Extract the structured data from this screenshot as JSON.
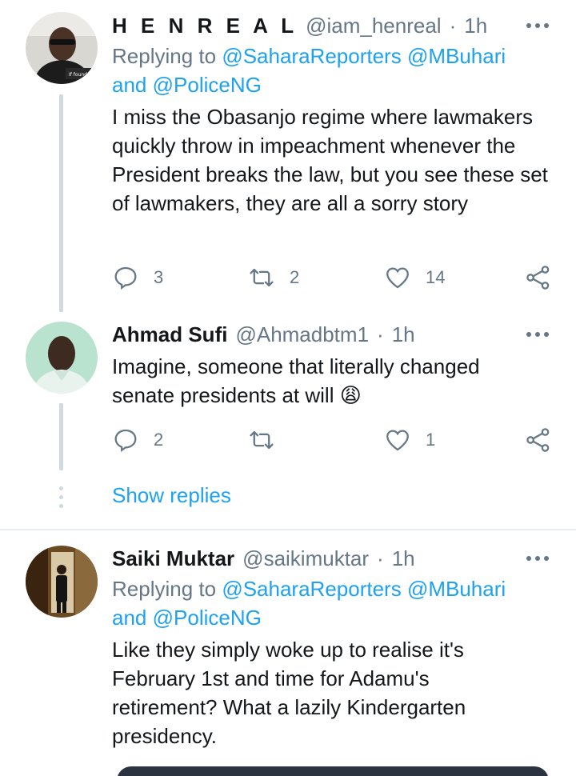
{
  "tweets": [
    {
      "name": "H E N R E A L",
      "handle": "@iam_henreal",
      "separator": "·",
      "time": "1h",
      "replying_prefix": "Replying to",
      "replying_to_1": "@SaharaReporters",
      "replying_to_2": "@MBuhari",
      "replying_and": "and",
      "replying_to_3": "@PoliceNG",
      "text": "I miss the Obasanjo regime where lawmakers quickly throw in impeachment whenever the President breaks the law, but you see these set of lawmakers, they are all a sorry story",
      "replies": "3",
      "retweets": "2",
      "likes": "14"
    },
    {
      "name": "Ahmad Sufi",
      "handle": "@Ahmadbtm1",
      "separator": "·",
      "time": "1h",
      "text": "Imagine, someone that literally changed senate presidents at will",
      "emoji": "😩",
      "replies": "2",
      "retweets": "",
      "likes": "1"
    },
    {
      "name": "Saiki Muktar",
      "handle": "@saikimuktar",
      "separator": "·",
      "time": "1h",
      "replying_prefix": "Replying to",
      "replying_to_1": "@SaharaReporters",
      "replying_to_2": "@MBuhari",
      "replying_and": "and",
      "replying_to_3": "@PoliceNG",
      "text": "Like they simply woke up to realise it's February 1st and time for Adamu's retirement? What a lazily Kindergarten presidency."
    }
  ],
  "show_replies": "Show replies",
  "colors": {
    "link": "#1da1f2",
    "muted": "#657786",
    "line": "#cfd9de"
  },
  "icons": [
    "more-icon",
    "reply-icon",
    "retweet-icon",
    "like-icon",
    "share-icon"
  ]
}
